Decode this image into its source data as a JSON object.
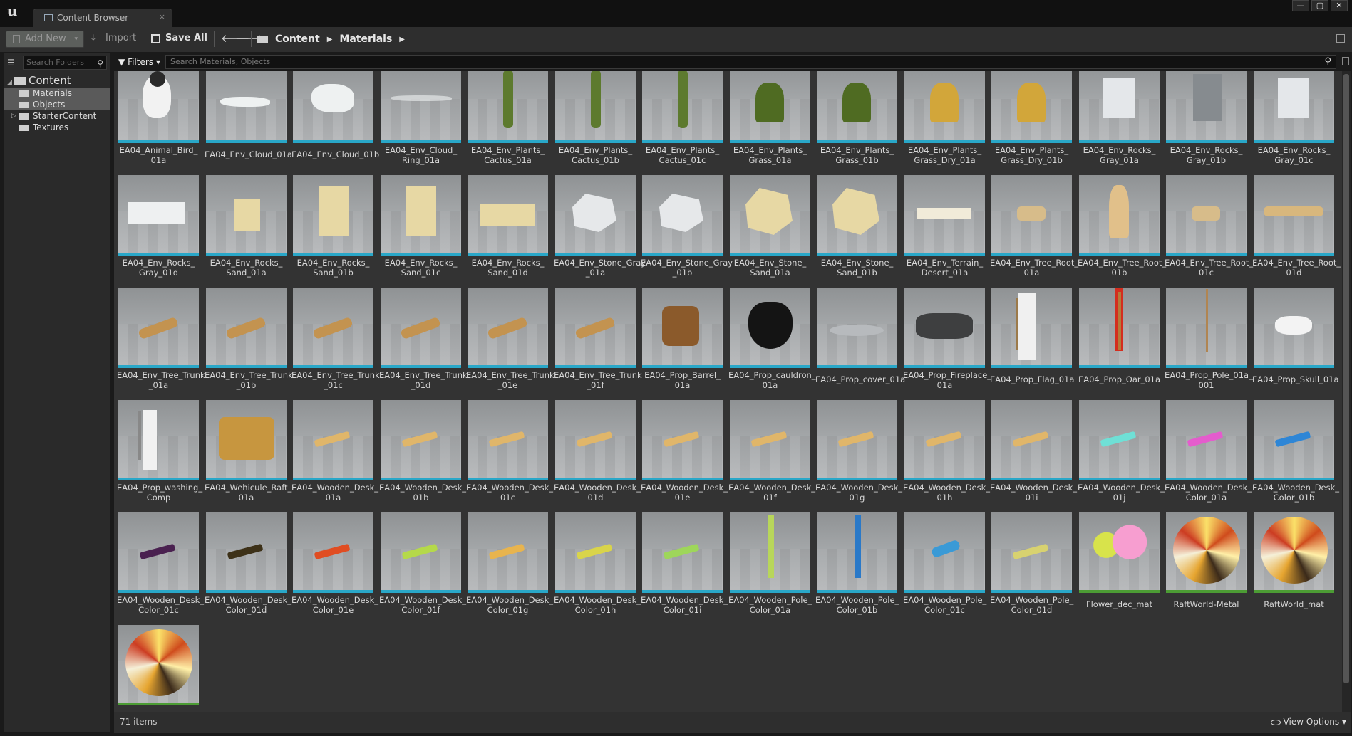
{
  "window": {
    "tab_title": "Content Browser",
    "tab_close": "×",
    "controls": [
      "—",
      "▢",
      "✕"
    ]
  },
  "toolbar": {
    "add_new": "Add New",
    "import": "Import",
    "save_all": "Save All",
    "breadcrumb": [
      "Content",
      "Materials"
    ]
  },
  "sources": {
    "search_placeholder": "Search Folders",
    "tree": [
      {
        "label": "Content",
        "level": 0,
        "expanded": true
      },
      {
        "label": "Materials",
        "level": 1,
        "selected": true
      },
      {
        "label": "Objects",
        "level": 1,
        "selected": true
      },
      {
        "label": "StarterContent",
        "level": 1,
        "collapsed": true
      },
      {
        "label": "Textures",
        "level": 1
      }
    ]
  },
  "filter": {
    "filters_label": "Filters",
    "search_placeholder": "Search Materials, Objects"
  },
  "assets": [
    {
      "name": "EA04_Animal_Bird_\n01a",
      "kind": "bird"
    },
    {
      "name": "EA04_Env_Cloud_01a",
      "kind": "cloud-flat"
    },
    {
      "name": "EA04_Env_Cloud_01b",
      "kind": "cloud"
    },
    {
      "name": "EA04_Env_Cloud_\nRing_01a",
      "kind": "cloud-ring"
    },
    {
      "name": "EA04_Env_Plants_\nCactus_01a",
      "kind": "cactus"
    },
    {
      "name": "EA04_Env_Plants_\nCactus_01b",
      "kind": "cactus"
    },
    {
      "name": "EA04_Env_Plants_\nCactus_01c",
      "kind": "cactus"
    },
    {
      "name": "EA04_Env_Plants_\nGrass_01a",
      "kind": "grass"
    },
    {
      "name": "EA04_Env_Plants_\nGrass_01b",
      "kind": "grass"
    },
    {
      "name": "EA04_Env_Plants_\nGrass_Dry_01a",
      "kind": "grass-dry"
    },
    {
      "name": "EA04_Env_Plants_\nGrass_Dry_01b",
      "kind": "grass-dry"
    },
    {
      "name": "EA04_Env_Rocks_\nGray_01a",
      "kind": "rock-gray"
    },
    {
      "name": "EA04_Env_Rocks_\nGray_01b",
      "kind": "rock-dark"
    },
    {
      "name": "EA04_Env_Rocks_\nGray_01c",
      "kind": "rock-gray"
    },
    {
      "name": "EA04_Env_Rocks_\nGray_01d",
      "kind": "rock-flat"
    },
    {
      "name": "EA04_Env_Rocks_\nSand_01a",
      "kind": "sand-small"
    },
    {
      "name": "EA04_Env_Rocks_\nSand_01b",
      "kind": "sand-tall"
    },
    {
      "name": "EA04_Env_Rocks_\nSand_01c",
      "kind": "sand-tall"
    },
    {
      "name": "EA04_Env_Rocks_\nSand_01d",
      "kind": "sand-flat"
    },
    {
      "name": "EA04_Env_Stone_Gray\n_01a",
      "kind": "stone-gray"
    },
    {
      "name": "EA04_Env_Stone_Gray\n_01b",
      "kind": "stone-gray"
    },
    {
      "name": "EA04_Env_Stone_\nSand_01a",
      "kind": "stone-sand"
    },
    {
      "name": "EA04_Env_Stone_\nSand_01b",
      "kind": "stone-sand"
    },
    {
      "name": "EA04_Env_Terrain_\nDesert_01a",
      "kind": "terrain"
    },
    {
      "name": "EA04_Env_Tree_Root_\n01a",
      "kind": "root"
    },
    {
      "name": "EA04_Env_Tree_Root_\n01b",
      "kind": "root-tall"
    },
    {
      "name": "EA04_Env_Tree_Root_\n01c",
      "kind": "root"
    },
    {
      "name": "EA04_Env_Tree_Root_\n01d",
      "kind": "root-long"
    },
    {
      "name": "EA04_Env_Tree_Trunk\n_01a",
      "kind": "trunk"
    },
    {
      "name": "EA04_Env_Tree_Trunk\n_01b",
      "kind": "trunk"
    },
    {
      "name": "EA04_Env_Tree_Trunk\n_01c",
      "kind": "trunk"
    },
    {
      "name": "EA04_Env_Tree_Trunk\n_01d",
      "kind": "trunk"
    },
    {
      "name": "EA04_Env_Tree_Trunk\n_01e",
      "kind": "trunk"
    },
    {
      "name": "EA04_Env_Tree_Trunk\n_01f",
      "kind": "trunk"
    },
    {
      "name": "EA04_Prop_Barrel_\n01a",
      "kind": "barrel"
    },
    {
      "name": "EA04_Prop_cauldron_\n01a",
      "kind": "cauldron"
    },
    {
      "name": "EA04_Prop_cover_01a",
      "kind": "cover"
    },
    {
      "name": "EA04_Prop_Fireplace_\n01a",
      "kind": "fireplace"
    },
    {
      "name": "EA04_Prop_Flag_01a",
      "kind": "flag"
    },
    {
      "name": "EA04_Prop_Oar_01a",
      "kind": "oar"
    },
    {
      "name": "EA04_Prop_Pole_01a_\n001",
      "kind": "pole"
    },
    {
      "name": "EA04_Prop_Skull_01a",
      "kind": "skull"
    },
    {
      "name": "EA04_Prop_washing_\nComp",
      "kind": "washing"
    },
    {
      "name": "EA04_Wehicule_Raft_\n01a",
      "kind": "raft"
    },
    {
      "name": "EA04_Wooden_Desk_\n01a",
      "kind": "desk"
    },
    {
      "name": "EA04_Wooden_Desk_\n01b",
      "kind": "desk"
    },
    {
      "name": "EA04_Wooden_Desk_\n01c",
      "kind": "desk"
    },
    {
      "name": "EA04_Wooden_Desk_\n01d",
      "kind": "desk"
    },
    {
      "name": "EA04_Wooden_Desk_\n01e",
      "kind": "desk"
    },
    {
      "name": "EA04_Wooden_Desk_\n01f",
      "kind": "desk"
    },
    {
      "name": "EA04_Wooden_Desk_\n01g",
      "kind": "desk"
    },
    {
      "name": "EA04_Wooden_Desk_\n01h",
      "kind": "desk"
    },
    {
      "name": "EA04_Wooden_Desk_\n01i",
      "kind": "desk"
    },
    {
      "name": "EA04_Wooden_Desk_\n01j",
      "kind": "desk",
      "color": "#6fe0d6"
    },
    {
      "name": "EA04_Wooden_Desk_\nColor_01a",
      "kind": "desk",
      "color": "#e45ccd"
    },
    {
      "name": "EA04_Wooden_Desk_\nColor_01b",
      "kind": "desk",
      "color": "#2e86d6"
    },
    {
      "name": "EA04_Wooden_Desk_\nColor_01c",
      "kind": "desk",
      "color": "#4a2150"
    },
    {
      "name": "EA04_Wooden_Desk_\nColor_01d",
      "kind": "desk",
      "color": "#3d3118"
    },
    {
      "name": "EA04_Wooden_Desk_\nColor_01e",
      "kind": "desk",
      "color": "#e04d22"
    },
    {
      "name": "EA04_Wooden_Desk_\nColor_01f",
      "kind": "desk",
      "color": "#b5d94a"
    },
    {
      "name": "EA04_Wooden_Desk_\nColor_01g",
      "kind": "desk",
      "color": "#e8b44e"
    },
    {
      "name": "EA04_Wooden_Desk_\nColor_01h",
      "kind": "desk",
      "color": "#d9d44a"
    },
    {
      "name": "EA04_Wooden_Desk_\nColor_01i",
      "kind": "desk",
      "color": "#9ed65a"
    },
    {
      "name": "EA04_Wooden_Pole_\nColor_01a",
      "kind": "pole-color",
      "color": "#b8d65a"
    },
    {
      "name": "EA04_Wooden_Pole_\nColor_01b",
      "kind": "pole-color",
      "color": "#2a79c8"
    },
    {
      "name": "EA04_Wooden_Pole_\nColor_01c",
      "kind": "hook",
      "color": "#3a9ad6"
    },
    {
      "name": "EA04_Wooden_Pole_\nColor_01d",
      "kind": "desk",
      "color": "#d8d270"
    },
    {
      "name": "Flower_dec_mat",
      "kind": "flower",
      "material": true
    },
    {
      "name": "RaftWorld-Metal",
      "kind": "ball",
      "material": true
    },
    {
      "name": "RaftWorld_mat",
      "kind": "ball",
      "material": true
    },
    {
      "name": "",
      "kind": "ball",
      "material": true
    }
  ],
  "status": {
    "item_count": "71 items",
    "view_options": "View Options"
  }
}
